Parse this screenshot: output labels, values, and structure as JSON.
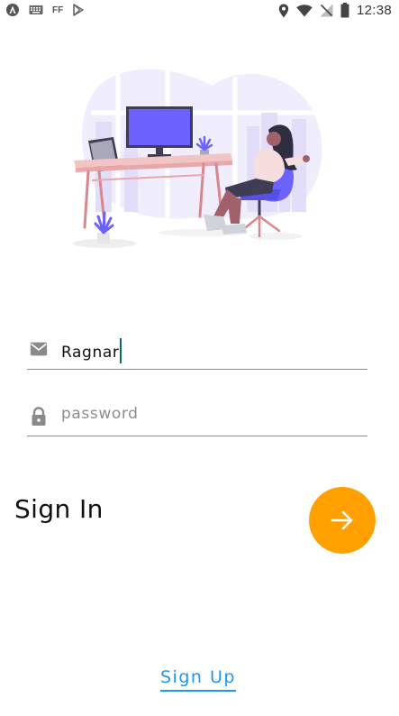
{
  "status_bar": {
    "time": "12:38",
    "left_icons": [
      "app-icon",
      "keyboard-icon",
      "ff-icon",
      "play-store-icon"
    ],
    "ff_label": "FF",
    "right_icons": [
      "location-icon",
      "wifi-icon",
      "no-signal-icon",
      "battery-icon"
    ]
  },
  "illustration": {
    "name": "work-desk-illustration",
    "colors": {
      "accent": "#6c63ff",
      "desk": "#f2c4c4",
      "desk_legs": "#d9868c",
      "backdrop": "#f0eefc"
    }
  },
  "form": {
    "email": {
      "icon": "mail-icon",
      "value": "Ragnar"
    },
    "password": {
      "icon": "lock-icon",
      "placeholder": "password"
    }
  },
  "signin": {
    "title": "Sign In",
    "button_icon": "arrow-right-icon",
    "button_color": "#ffa000"
  },
  "signup": {
    "label": "Sign Up",
    "color": "#2196f3"
  }
}
